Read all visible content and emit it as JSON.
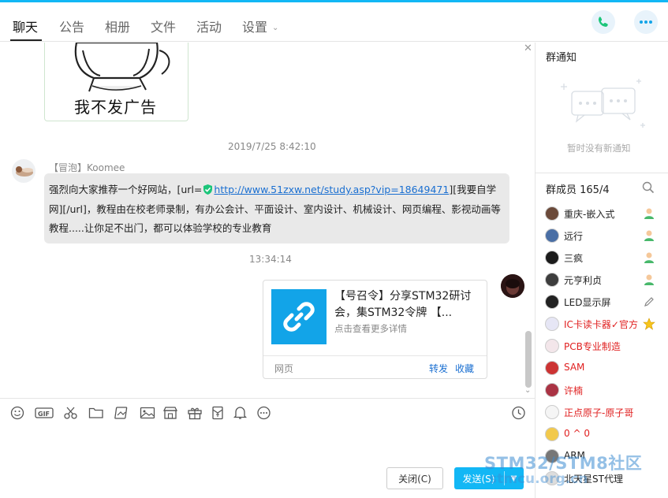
{
  "header": {
    "tabs": [
      {
        "label": "聊天"
      },
      {
        "label": "公告"
      },
      {
        "label": "相册"
      },
      {
        "label": "文件"
      },
      {
        "label": "活动"
      },
      {
        "label": "设置"
      }
    ],
    "active_tab": 0
  },
  "chat": {
    "sticker_text": "我不发广告",
    "messages": [
      {
        "timestamp": "2019/7/25 8:42:10",
        "sender": "【冒泡】Koomee",
        "text_before": "强烈向大家推荐一个好网站，[url=",
        "link": "http://www.51zxw.net/study.asp?vip=18649471",
        "text_after": "][我要自学网][/url]，教程由在校老师录制，有办公会计、平面设计、室内设计、机械设计、网页编程、影视动画等教程.....让你足不出门，都可以体验学校的专业教育"
      },
      {
        "timestamp": "13:34:14",
        "card": {
          "title": "【号召令】分享STM32研讨会，集STM32令牌 【...",
          "subtitle": "点击查看更多详情",
          "source": "网页",
          "forward": "转发",
          "collect": "收藏"
        }
      }
    ]
  },
  "input": {
    "close_label": "关闭(C)",
    "send_label": "发送(S)"
  },
  "sidebar": {
    "notice_title": "群通知",
    "notice_empty": "暂时没有新通知",
    "members_title": "群成员 165/4",
    "members": [
      {
        "name": "重庆-嵌入式",
        "color": "#222222",
        "badge": "admin-icon"
      },
      {
        "name": "远行",
        "color": "#222222",
        "badge": "admin-icon"
      },
      {
        "name": "三疯",
        "color": "#222222",
        "badge": "admin-icon"
      },
      {
        "name": "元亨利贞",
        "color": "#222222",
        "badge": "admin-icon"
      },
      {
        "name": "LED显示屏",
        "color": "#222222",
        "badge": "edit-icon"
      },
      {
        "name": "IC卡读卡器✓官方",
        "color": "#e02020",
        "badge": "star-icon"
      },
      {
        "name": "PCB专业制造",
        "color": "#e02020",
        "badge": ""
      },
      {
        "name": "SAM",
        "color": "#e02020",
        "badge": ""
      },
      {
        "name": "许楠",
        "color": "#e02020",
        "badge": ""
      },
      {
        "name": "正点原子-原子哥",
        "color": "#e02020",
        "badge": ""
      },
      {
        "name": "0 ^ 0",
        "color": "#e02020",
        "badge": ""
      },
      {
        "name": "ARM",
        "color": "#222222",
        "badge": ""
      },
      {
        "name": "北天星ST代理",
        "color": "#222222",
        "badge": ""
      }
    ]
  },
  "watermark": {
    "line1": "STM32/STM8社区",
    "line2": "stmcu.org.cn"
  },
  "colors": {
    "accent": "#12b7f5",
    "link": "#1a6fd1",
    "vip_red": "#e02020"
  }
}
